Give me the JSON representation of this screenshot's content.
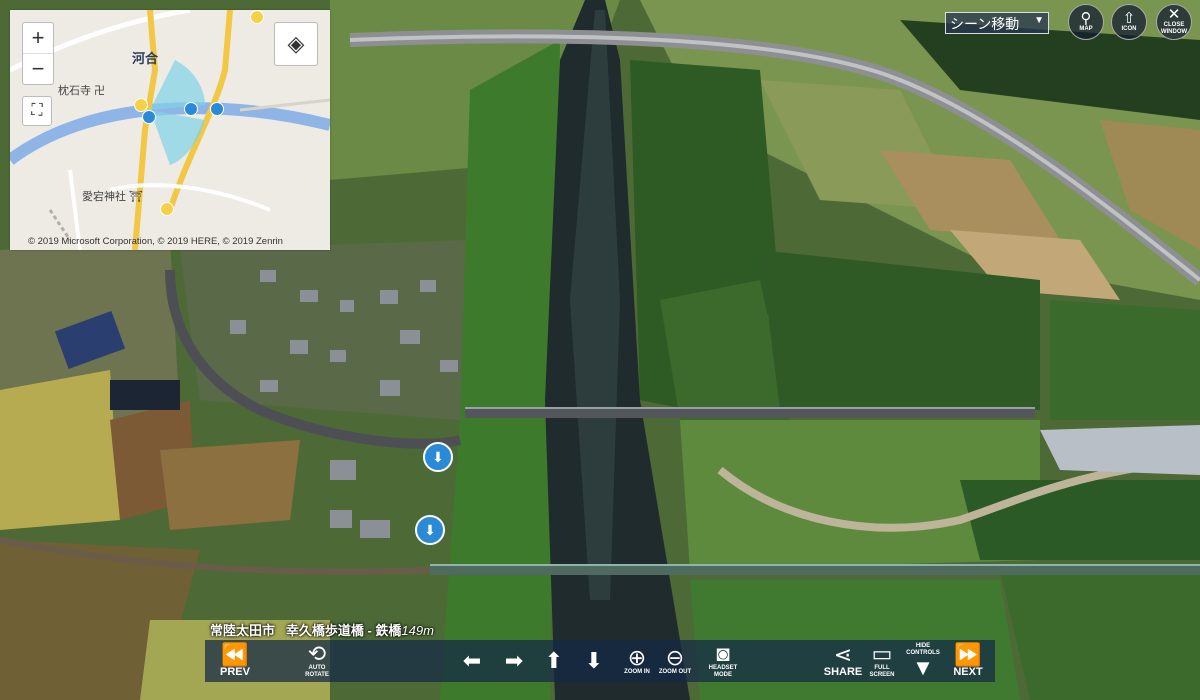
{
  "map": {
    "labels": {
      "town": "河合",
      "temple": "枕石寺 卍",
      "shrine": "愛宕神社 ⛩"
    },
    "copyright": "© 2019 Microsoft Corporation, © 2019 HERE, © 2019 Zenrin",
    "zoom_in": "+",
    "zoom_out": "−"
  },
  "top_controls": {
    "scene_move": "シーン移動",
    "map_label": "MAP",
    "icon_label": "ICON",
    "close_label_1": "CLOSE",
    "close_label_2": "WINDOW"
  },
  "caption": {
    "city": "常陸太田市",
    "place": "幸久橋歩道橋 - 鉄橋",
    "distance": "149m"
  },
  "toolbar": {
    "prev": "PREV",
    "auto_rotate_1": "AUTO",
    "auto_rotate_2": "ROTATE",
    "zoom_in": "ZOOM IN",
    "zoom_out": "ZOOM OUT",
    "headset_1": "HEADSET",
    "headset_2": "MODE",
    "share": "SHARE",
    "full_screen_1": "FULL",
    "full_screen_2": "SCREEN",
    "hide_controls_1": "HIDE",
    "hide_controls_2": "CONTROLS",
    "next": "NEXT"
  },
  "colors": {
    "toolbar_bg": "#14284699",
    "hotspot": "#2b8ad8",
    "map_water": "#8fb4e6",
    "map_road": "#f2c744"
  }
}
